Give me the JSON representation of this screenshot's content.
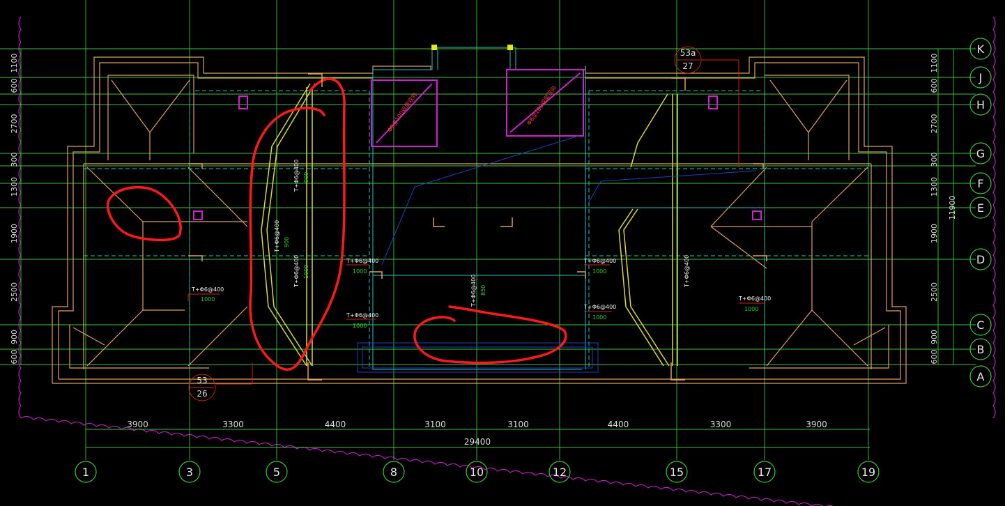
{
  "drawing": {
    "grid_columns": [
      "1",
      "3",
      "5",
      "8",
      "10",
      "12",
      "15",
      "17",
      "19"
    ],
    "grid_rows": [
      "K",
      "J",
      "H",
      "G",
      "F",
      "E",
      "D",
      "C",
      "B",
      "A"
    ],
    "bottom_dimensions": [
      "3900",
      "3300",
      "4400",
      "3100",
      "3100",
      "4400",
      "3300",
      "3900"
    ],
    "total_dimension": "29400",
    "left_dimensions": [
      "1100",
      "600",
      "2700",
      "300",
      "1300",
      "1900",
      "2500",
      "900",
      "600"
    ],
    "right_dimensions": [
      "1100",
      "600",
      "2700",
      "300",
      "1300",
      "1900",
      "2500",
      "900",
      "600"
    ],
    "right_total": "11900",
    "section_marks": [
      {
        "top": "53a",
        "bottom": "27"
      },
      {
        "top": "53",
        "bottom": "26"
      }
    ],
    "rebar_notes": [
      {
        "text": "T+Φ6@400",
        "sub": "1000"
      },
      {
        "text": "T+Φ6@400",
        "sub": "1000"
      },
      {
        "text": "T+Φ6@400",
        "sub": "1000"
      },
      {
        "text": "T+Φ6@400",
        "sub": "1000"
      },
      {
        "text": "T+Φ6@400",
        "sub": "1000"
      },
      {
        "text": "T+Φ6@400",
        "sub": "1000"
      },
      {
        "text": "T+Φ6@400",
        "sub": "850"
      }
    ],
    "vertical_notes": [
      {
        "text": "T+Φ6@400",
        "sub": "900"
      },
      {
        "text": "T+Φ6@400",
        "sub": "900"
      },
      {
        "text": "T+Φ6@400",
        "sub": "1000"
      },
      {
        "text": "T+Φ6@400",
        "sub": ""
      }
    ],
    "slab_notes": [
      "Φ8@100双层双向",
      "Φ8@100双层双向"
    ],
    "colors": {
      "background": "#000000",
      "grid": "#5fd35f",
      "wall": "#e0a060",
      "beam": "#25c0c0",
      "yellow": "#d8d840",
      "magenta": "#d020d0",
      "markup": "#ff1a1a",
      "blue": "#2040c0"
    }
  }
}
